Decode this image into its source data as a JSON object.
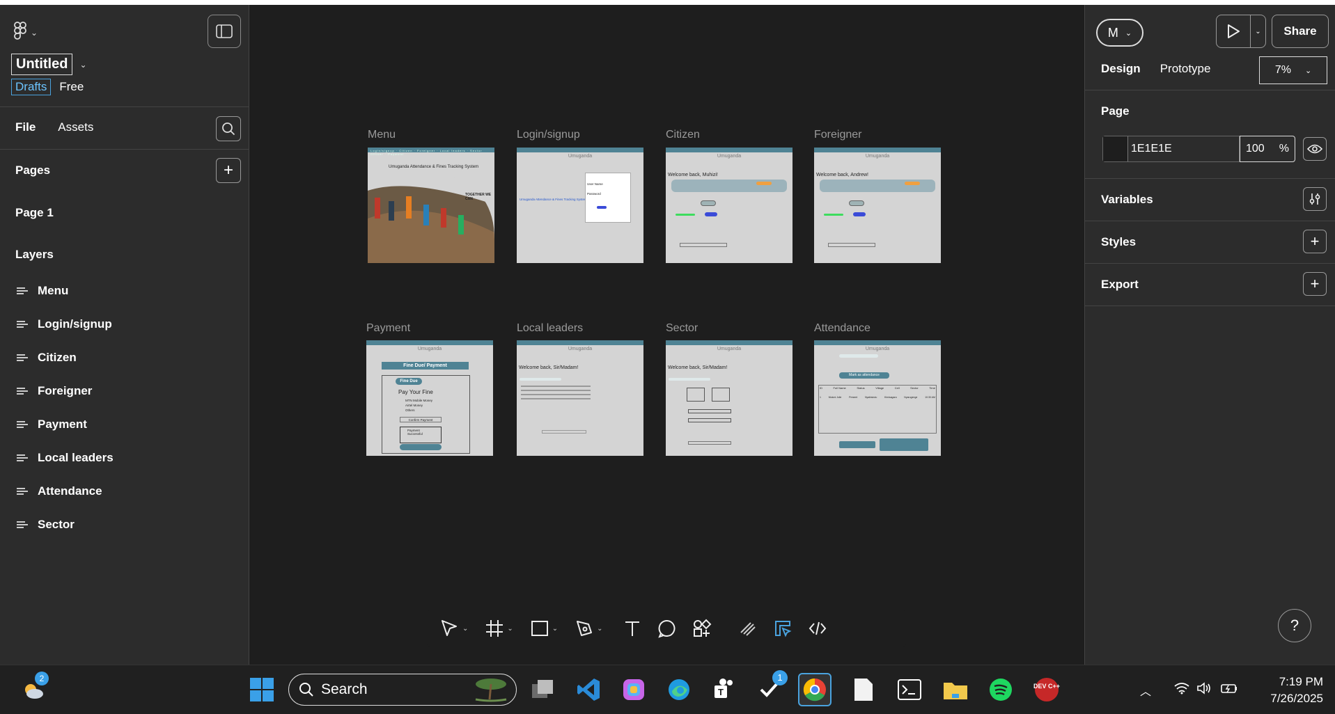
{
  "file": {
    "name": "Untitled",
    "location": "Drafts",
    "plan": "Free"
  },
  "left_panel": {
    "tabs": [
      "File",
      "Assets"
    ],
    "pages_title": "Pages",
    "pages": [
      "Page 1"
    ],
    "layers_title": "Layers",
    "layers": [
      "Menu",
      "Login/signup",
      "Citizen",
      "Foreigner",
      "Payment",
      "Local leaders",
      "Attendance",
      "Sector"
    ]
  },
  "canvas": {
    "frames": [
      {
        "label": "Menu",
        "title": "Umuganda Attendance & Fines Tracking System",
        "tagline": "TOGETHER WE CAN",
        "nav": [
          "Login/signup",
          "Citizen",
          "Foreigner",
          "Local leaders",
          "Sector Officer",
          "Payment"
        ]
      },
      {
        "label": "Login/signup",
        "app": "Umuganda",
        "heading": "Umuganda Attendance & Fines Tracking System",
        "fields": [
          "User Name",
          "Password"
        ]
      },
      {
        "label": "Citizen",
        "app": "Umuganda",
        "welcome": "Welcome back, Muhizi!"
      },
      {
        "label": "Foreigner",
        "app": "Umuganda",
        "welcome": "Welcome back, Andrew!"
      },
      {
        "label": "Payment",
        "app": "Umuganda",
        "header": "Fine Due/ Payment",
        "badge": "Fine Due",
        "subtitle": "Pay Your Fine",
        "options": [
          "MTN Mobile Money",
          "Airtel Money",
          "Others"
        ],
        "button": "Confirm Payment",
        "success": "Payment Successful"
      },
      {
        "label": "Local leaders",
        "app": "Umuganda",
        "welcome": "Welcome back, Sir/Madam!"
      },
      {
        "label": "Sector",
        "app": "Umuganda",
        "welcome": "Welcome back, Sir/Madam!"
      },
      {
        "label": "Attendance",
        "app": "Umuganda",
        "button": "Mark as attendance",
        "columns": [
          "ID",
          "Full Name",
          "Status",
          "Village",
          "Cell",
          "Sector",
          "Time"
        ],
        "row": [
          "1",
          "Mutoni Jolie",
          "Present",
          "Nyabisindu",
          "Kimisagara",
          "Nyarugenge",
          "10:30 AM"
        ]
      }
    ]
  },
  "toolbar": {
    "tools": [
      "move-tool",
      "frame-tool",
      "rectangle-tool",
      "pen-tool",
      "text-tool",
      "comment-tool",
      "actions-tool",
      "draw-tool",
      "design-mode",
      "dev-mode"
    ]
  },
  "right_panel": {
    "avatar_initial": "M",
    "share_label": "Share",
    "tabs": [
      "Design",
      "Prototype"
    ],
    "zoom": "7%",
    "page_section": "Page",
    "bg_color_hex": "1E1E1E",
    "bg_opacity": "100",
    "opacity_unit": "%",
    "sections": [
      "Variables",
      "Styles",
      "Export"
    ],
    "help_label": "?"
  },
  "taskbar": {
    "weather_badge": "2",
    "search_placeholder": "Search",
    "todo_badge": "1",
    "time": "7:19 PM",
    "date": "7/26/2025",
    "devcpp_label": "DEV C++"
  },
  "colors": {
    "canvas_bg": "#1e1e1e",
    "panel_bg": "#2c2c2c",
    "frame_accent": "#4f8394",
    "selection_blue": "#4aa3df"
  }
}
